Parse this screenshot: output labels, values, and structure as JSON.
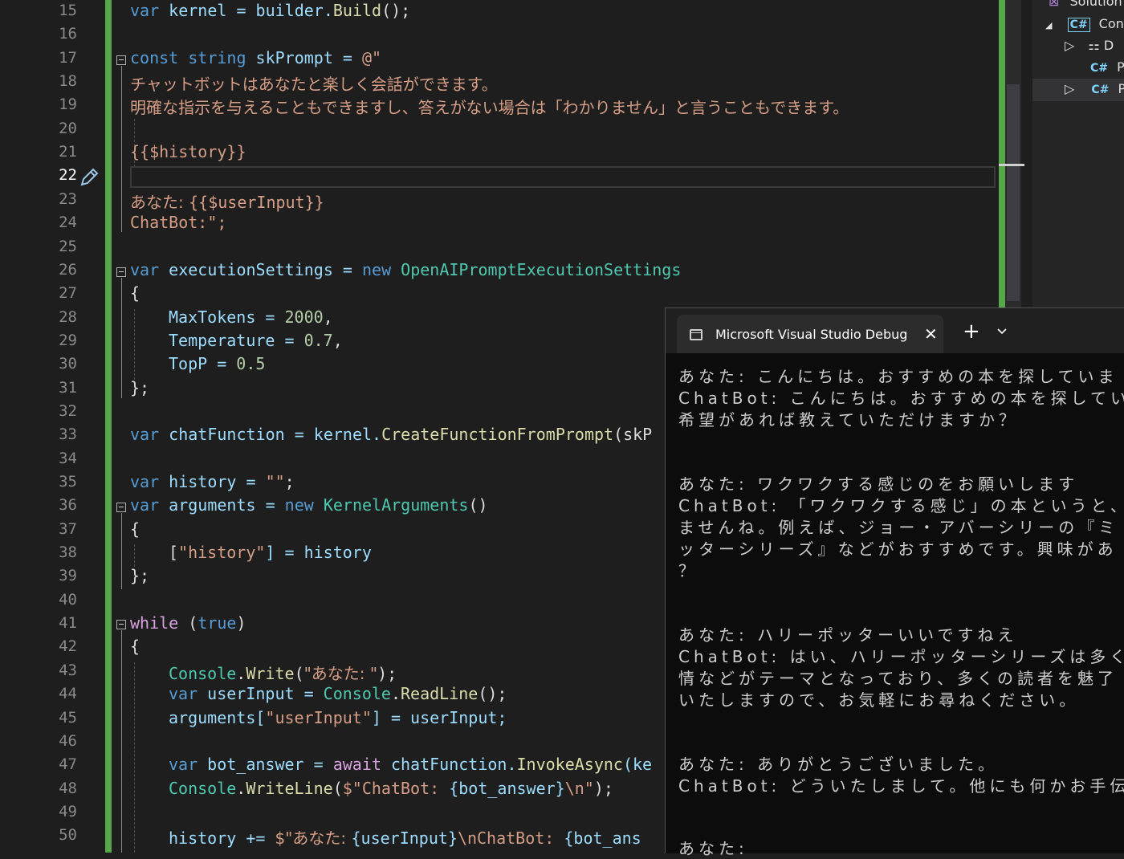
{
  "editor": {
    "line_numbers": [
      "15",
      "16",
      "17",
      "18",
      "19",
      "20",
      "21",
      "22",
      "23",
      "24",
      "25",
      "26",
      "27",
      "28",
      "29",
      "30",
      "31",
      "32",
      "33",
      "34",
      "35",
      "36",
      "37",
      "38",
      "39",
      "40",
      "41",
      "42",
      "43",
      "44",
      "45",
      "46",
      "47",
      "48",
      "49",
      "50"
    ],
    "lines": {
      "l15": [
        "var",
        " kernel = builder.",
        "Build",
        "();"
      ],
      "l17": [
        "const",
        " ",
        "string",
        " skPrompt = ",
        "@\""
      ],
      "l18": "チャットボットはあなたと楽しく会話ができます。",
      "l19": "明確な指示を与えることもできますし、答えがない場合は「わかりません」と言うこともできます。",
      "l21": "{{$history}}",
      "l23a": "あなた: ",
      "l23b": "{{$userInput}}",
      "l24": "ChatBot:\";",
      "l26": [
        "var",
        " executionSettings = ",
        "new",
        " ",
        "OpenAIPromptExecutionSettings"
      ],
      "l27": "{",
      "l28": [
        "MaxTokens = ",
        "2000",
        ","
      ],
      "l29": [
        "Temperature = ",
        "0.7",
        ","
      ],
      "l30": [
        "TopP = ",
        "0.5"
      ],
      "l31": "};",
      "l33": [
        "var",
        " chatFunction = kernel.",
        "CreateFunctionFromPrompt",
        "(skP"
      ],
      "l35": [
        "var",
        " history = ",
        "\"\"",
        ";"
      ],
      "l36": [
        "var",
        " arguments = ",
        "new",
        " ",
        "KernelArguments",
        "()"
      ],
      "l37": "{",
      "l38": [
        "[",
        "\"history\"",
        "] = history"
      ],
      "l39": "};",
      "l41": [
        "while",
        " (",
        "true",
        ")"
      ],
      "l42": "{",
      "l43": [
        "Console",
        ".",
        "Write",
        "(",
        "\"あなた: \"",
        ");"
      ],
      "l44": [
        "var",
        " userInput = ",
        "Console",
        ".",
        "ReadLine",
        "();"
      ],
      "l45": [
        "arguments[",
        "\"userInput\"",
        "] = userInput;"
      ],
      "l47": [
        "var",
        " bot_answer = ",
        "await",
        " chatFunction.",
        "InvokeAsync",
        "(ke"
      ],
      "l48": [
        "Console",
        ".",
        "WriteLine",
        "(",
        "$\"ChatBot: ",
        "{bot_answer}",
        "\\n\"",
        ");"
      ],
      "l50": [
        "history += ",
        "$\"あなた: ",
        "{userInput}",
        "\\nChatBot: ",
        "{bot_ans"
      ]
    }
  },
  "solution_explorer": {
    "root": "Solution",
    "project": "Cons",
    "items": [
      "D",
      "P",
      "P"
    ],
    "cs_badge": "C#"
  },
  "terminal": {
    "tab_title": "Microsoft Visual Studio Debug",
    "close": "✕",
    "new_tab": "+",
    "dropdown": "⌄",
    "output": [
      "あなた: こんにちは。おすすめの本を探していま",
      "ChatBot: こんにちは。おすすめの本を探してい",
      "希望があれば教えていただけますか？",
      "あなた: ワクワクする感じのをお願いします",
      "ChatBot: 「ワクワクする感じ」の本というと、",
      "ませんね。例えば、ジョー・アバーシリーの『ミ",
      "ッターシリーズ』などがおすすめです。興味があ",
      "？",
      "あなた: ハリーポッターいいですねえ",
      "ChatBot: はい、ハリーポッターシリーズは多く",
      "情などがテーマとなっており、多くの読者を魅了",
      "いたしますので、お気軽にお尋ねください。",
      "あなた: ありがとうございました。",
      "ChatBot: どういたしまして。他にも何かお手伝",
      "あなた:"
    ]
  }
}
